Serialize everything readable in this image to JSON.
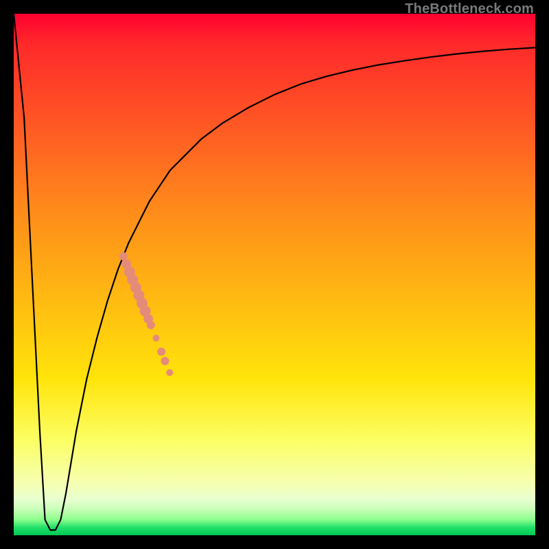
{
  "attribution": "TheBottleneck.com",
  "palette": {
    "frame": "#000000",
    "curve_stroke": "#000000",
    "marker_fill": "#e58b7a",
    "attribution_text": "#7a7a7a"
  },
  "chart_data": {
    "type": "line",
    "title": "",
    "xlabel": "",
    "ylabel": "",
    "xlim": [
      0,
      100
    ],
    "ylim": [
      0,
      100
    ],
    "grid": false,
    "legend": false,
    "series": [
      {
        "name": "bottleneck-curve",
        "x": [
          0,
          2,
          3,
          4,
          5,
          6,
          7,
          8,
          9,
          10,
          11,
          12,
          14,
          16,
          18,
          20,
          22,
          24,
          26,
          28,
          30,
          33,
          36,
          40,
          45,
          50,
          55,
          60,
          65,
          70,
          75,
          80,
          85,
          90,
          95,
          100
        ],
        "values": [
          100,
          80,
          60,
          40,
          20,
          3,
          1,
          1,
          3,
          8,
          14,
          20,
          30,
          38,
          45,
          51,
          56,
          60,
          64,
          67,
          70,
          73,
          76,
          79,
          82,
          84.5,
          86.5,
          88,
          89.2,
          90.2,
          91,
          91.7,
          92.3,
          92.8,
          93.2,
          93.5
        ]
      }
    ],
    "markers": [
      {
        "name": "cluster-top-start",
        "x": 21.0,
        "y": 53.5,
        "r": 6
      },
      {
        "name": "cluster-top-a",
        "x": 21.6,
        "y": 52.0,
        "r": 7
      },
      {
        "name": "cluster-top-b",
        "x": 22.2,
        "y": 50.5,
        "r": 8
      },
      {
        "name": "cluster-top-c",
        "x": 22.8,
        "y": 49.0,
        "r": 8
      },
      {
        "name": "cluster-top-d",
        "x": 23.4,
        "y": 47.5,
        "r": 8
      },
      {
        "name": "cluster-top-e",
        "x": 24.0,
        "y": 46.0,
        "r": 8
      },
      {
        "name": "cluster-top-f",
        "x": 24.6,
        "y": 44.5,
        "r": 8
      },
      {
        "name": "cluster-top-g",
        "x": 25.2,
        "y": 43.0,
        "r": 8
      },
      {
        "name": "cluster-top-h",
        "x": 25.8,
        "y": 41.5,
        "r": 7
      },
      {
        "name": "cluster-top-end",
        "x": 26.3,
        "y": 40.3,
        "r": 6
      },
      {
        "name": "mid-gap-dot",
        "x": 27.3,
        "y": 37.8,
        "r": 5
      },
      {
        "name": "lower-pair-a",
        "x": 28.3,
        "y": 35.2,
        "r": 6
      },
      {
        "name": "lower-pair-b",
        "x": 29.0,
        "y": 33.4,
        "r": 6
      },
      {
        "name": "tail-dot",
        "x": 29.9,
        "y": 31.2,
        "r": 5
      }
    ]
  }
}
